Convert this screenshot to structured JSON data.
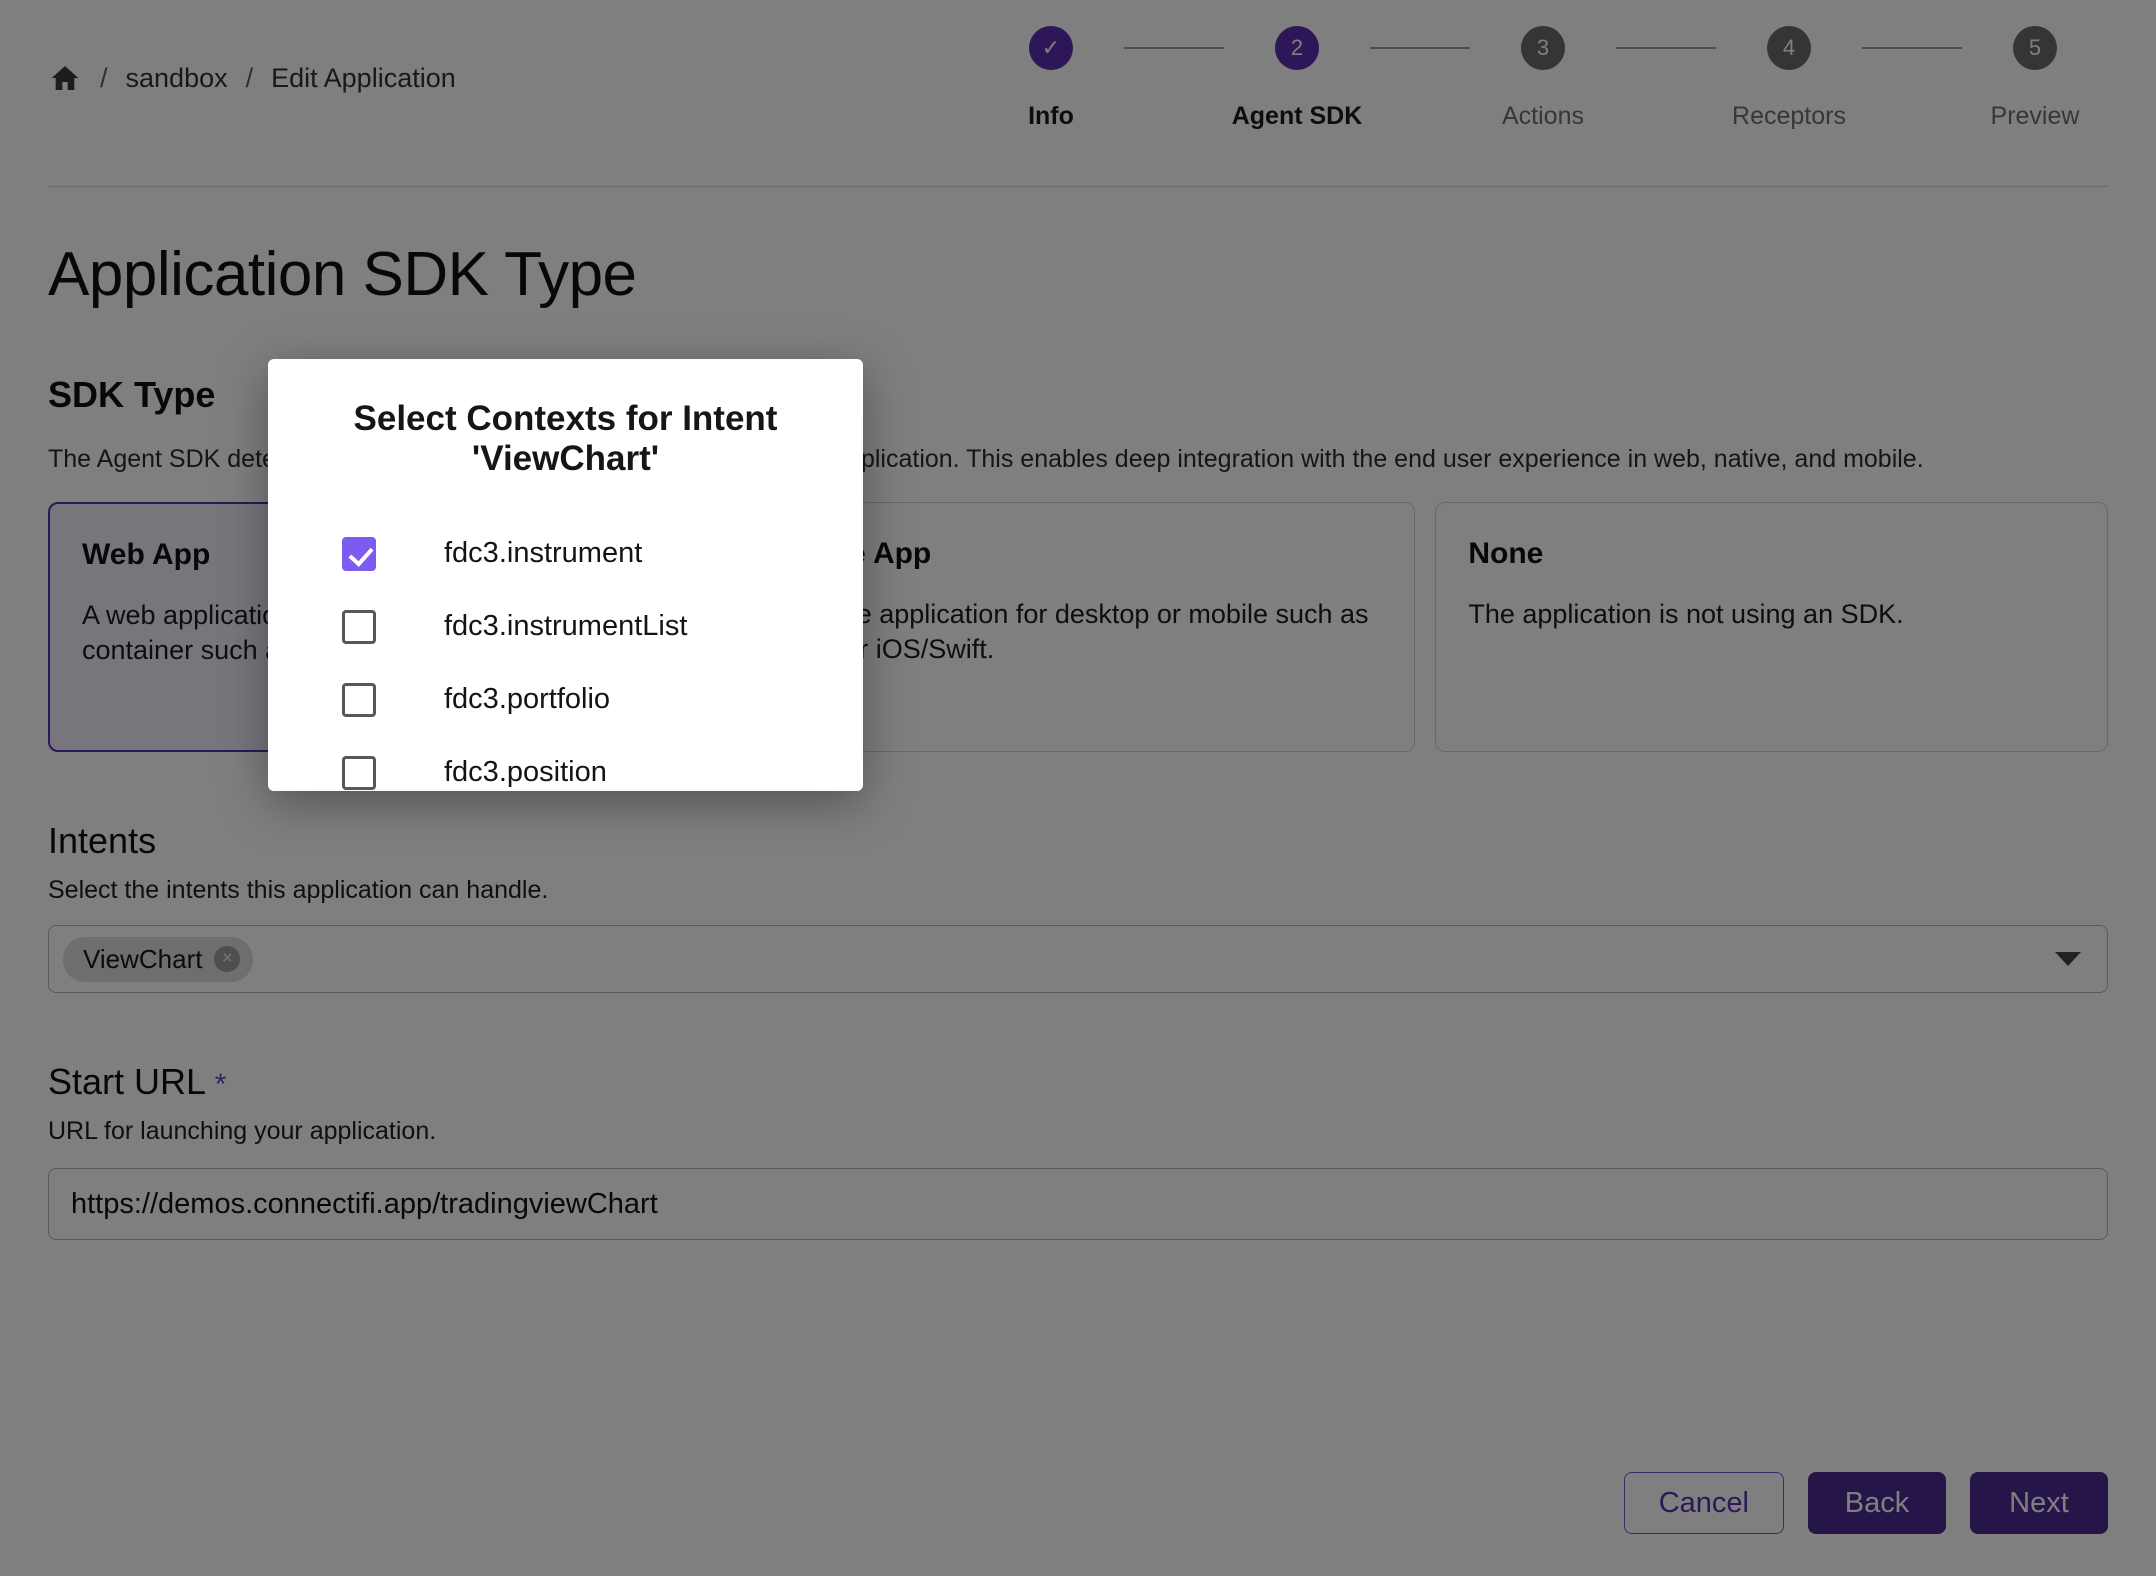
{
  "breadcrumb": {
    "home_icon": "home-icon",
    "separator": "/",
    "items": [
      "sandbox",
      "Edit Application"
    ]
  },
  "stepper": {
    "steps": [
      {
        "number": "✓",
        "label": "Info",
        "state": "done"
      },
      {
        "number": "2",
        "label": "Agent SDK",
        "state": "active"
      },
      {
        "number": "3",
        "label": "Actions",
        "state": "inactive"
      },
      {
        "number": "4",
        "label": "Receptors",
        "state": "inactive"
      },
      {
        "number": "5",
        "label": "Preview",
        "state": "inactive"
      }
    ]
  },
  "page": {
    "title": "Application SDK Type",
    "sdk_section_title": "SDK Type",
    "sdk_section_desc": "The Agent SDK determines the behavior of the FDC3 client API for the application. This enables deep integration with the end user experience in web, native, and mobile."
  },
  "cards": [
    {
      "title": "Web App",
      "desc": "A web application running in a browser, PWA, or a container such as Electronjs or WebView.",
      "selected": true
    },
    {
      "title": "Native App",
      "desc": "A native application for desktop or mobile such as .NET or iOS/Swift.",
      "selected": false
    },
    {
      "title": "None",
      "desc": "The application is not using an SDK.",
      "selected": false
    }
  ],
  "intents": {
    "title": "Intents",
    "desc": "Select the intents this application can handle.",
    "chips": [
      {
        "label": "ViewChart",
        "remove_icon": "×"
      }
    ],
    "caret_icon": "chevron-down-icon"
  },
  "start_url": {
    "title": "Start URL",
    "required_marker": "*",
    "desc": "URL for launching your application.",
    "value": "https://demos.connectifi.app/tradingviewChart"
  },
  "footer": {
    "cancel_label": "Cancel",
    "back_label": "Back",
    "next_label": "Next"
  },
  "modal": {
    "title": "Select Contexts for Intent 'ViewChart'",
    "contexts": [
      {
        "label": "fdc3.instrument",
        "checked": true
      },
      {
        "label": "fdc3.instrumentList",
        "checked": false
      },
      {
        "label": "fdc3.portfolio",
        "checked": false
      },
      {
        "label": "fdc3.position",
        "checked": false
      }
    ]
  },
  "colors": {
    "accent": "#5b2fb0",
    "accent_light": "#7c5cf0",
    "primary_button": "#4a2a93",
    "overlay": "rgba(0,0,0,0.5)"
  }
}
